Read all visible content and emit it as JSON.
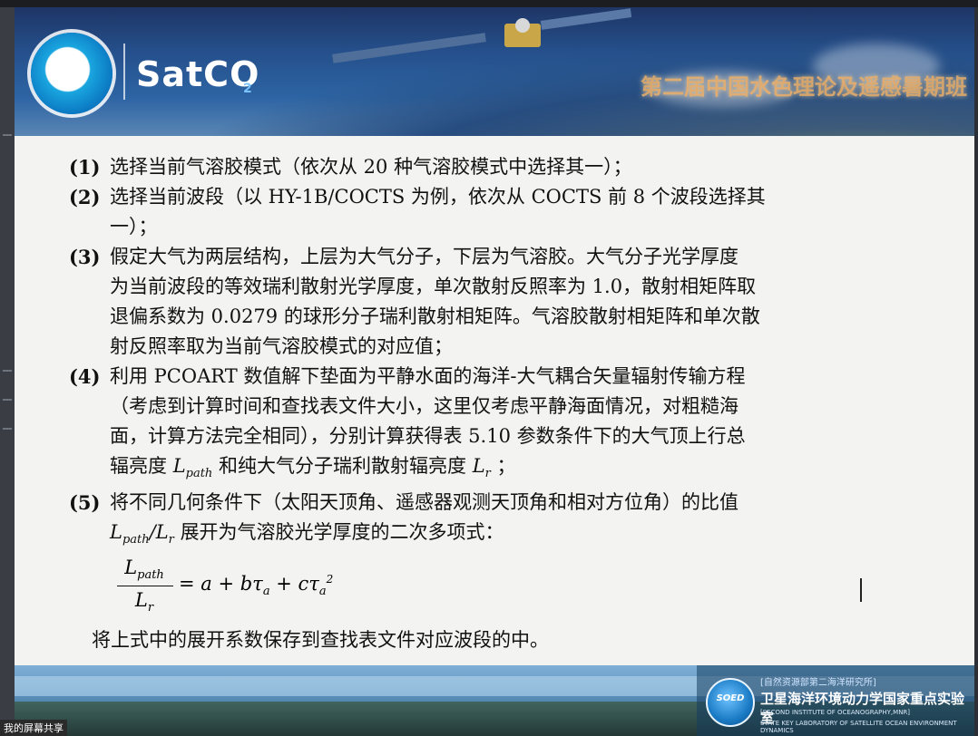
{
  "banner": {
    "brand": "SatCO",
    "brand_sub": "2",
    "title": "第二届中国水色理论及遥感暑期班"
  },
  "items": [
    {
      "num": "(1)",
      "lines": [
        "选择当前气溶胶模式（依次从 20 种气溶胶模式中选择其一）；"
      ]
    },
    {
      "num": "(2)",
      "lines": [
        "选择当前波段（以 HY-1B/COCTS 为例，依次从 COCTS 前 8 个波段选择其",
        "一）；"
      ]
    },
    {
      "num": "(3)",
      "lines": [
        "假定大气为两层结构，上层为大气分子，下层为气溶胶。大气分子光学厚度",
        "为当前波段的等效瑞利散射光学厚度，单次散射反照率为 1.0，散射相矩阵取",
        "退偏系数为 0.0279 的球形分子瑞利散射相矩阵。气溶胶散射相矩阵和单次散",
        "射反照率取为当前气溶胶模式的对应值；"
      ]
    },
    {
      "num": "(4)",
      "lines": [
        "利用 PCOART 数值解下垫面为平静水面的海洋-大气耦合矢量辐射传输方程",
        "（考虑到计算时间和查找表文件大小，这里仅考虑平静海面情况，对粗糙海",
        "面，计算方法完全相同），分别计算获得表 5.10 参数条件下的大气顶上行总"
      ]
    },
    {
      "num": "(5)",
      "lines": [
        "将不同几何条件下（太阳天顶角、遥感器观测天顶角和相对方位角）的比值"
      ]
    }
  ],
  "item4_last": {
    "pre": "辐亮度",
    "mid": "和纯大气分子瑞利散射辐亮度",
    "post": "；"
  },
  "item5_last": {
    "post": "展开为气溶胶光学厚度的二次多项式："
  },
  "math": {
    "L": "L",
    "path": "path",
    "r": "r",
    "slash": "/",
    "eq": "= a + bτ",
    "a": "a",
    "plus": " + cτ",
    "sq": "2"
  },
  "summary": "将上式中的展开系数保存到查找表文件对应波段的中。",
  "footer": {
    "line1": "[自然资源部第二海洋研究所]",
    "line2": "卫星海洋环境动力学国家重点实验室",
    "line3": "[SECOND INSTITUTE OF OCEANOGRAPHY,MNR]",
    "line4": "STATE KEY LABORATORY OF SATELLITE OCEAN ENVIRONMENT DYNAMICS",
    "logo_text": "SOED"
  },
  "share_tag": "我的屏幕共享"
}
